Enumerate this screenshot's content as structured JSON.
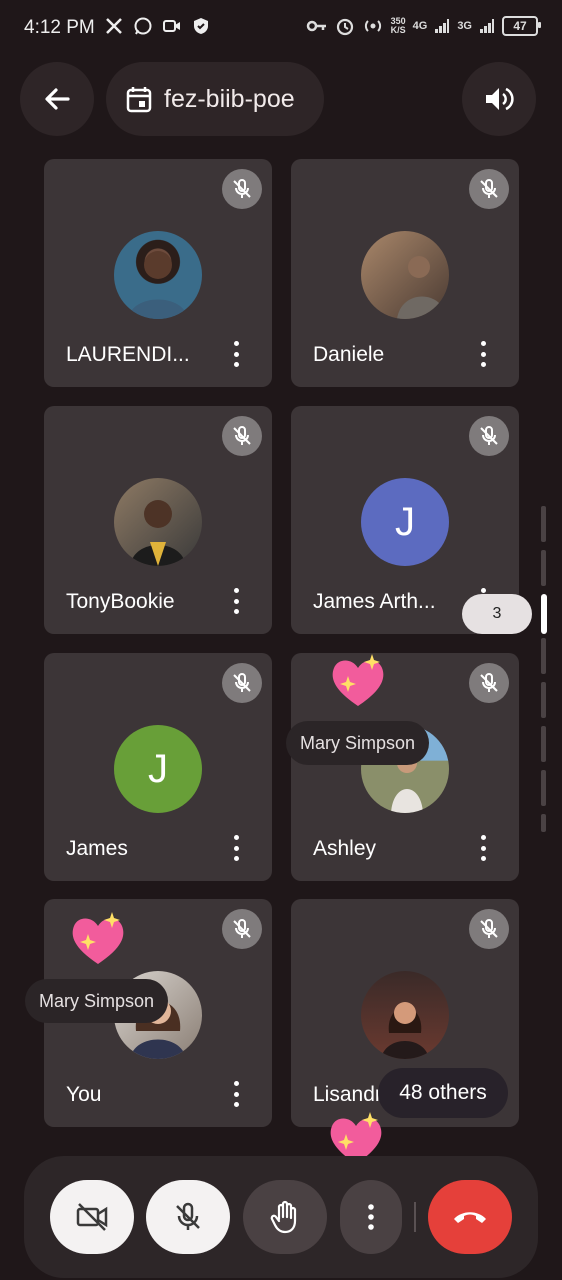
{
  "status_bar": {
    "time": "4:12 PM",
    "net_speed_value": "350",
    "net_speed_unit": "K/S",
    "net_type_1": "4G",
    "net_type_2": "3G",
    "battery": "47"
  },
  "top_bar": {
    "meeting_code": "fez-biib-poe"
  },
  "tiles": [
    {
      "name": "LAURENDI...",
      "muted": true,
      "avatar_type": "photo"
    },
    {
      "name": "Daniele",
      "muted": true,
      "avatar_type": "photo"
    },
    {
      "name": "TonyBookie",
      "muted": true,
      "avatar_type": "photo"
    },
    {
      "name": "James Arth...",
      "muted": true,
      "avatar_type": "initial",
      "initial": "J",
      "color": "#5c6bc0"
    },
    {
      "name": "James",
      "muted": true,
      "avatar_type": "initial",
      "initial": "J",
      "color": "#689f38"
    },
    {
      "name": "Ashley",
      "muted": true,
      "avatar_type": "photo"
    },
    {
      "name": "You",
      "muted": true,
      "avatar_type": "photo"
    },
    {
      "name": "Lisandro",
      "muted": true,
      "avatar_type": "photo"
    }
  ],
  "reactions": [
    {
      "emoji": "sparkling-heart",
      "sender": "Mary Simpson"
    },
    {
      "emoji": "sparkling-heart",
      "sender": "Mary Simpson"
    },
    {
      "emoji": "sparkling-heart"
    }
  ],
  "pagination": {
    "current_page": "3"
  },
  "others_chip": {
    "label": "48 others"
  },
  "controls": {
    "camera": "camera-off-icon",
    "mic": "mic-off-icon",
    "hand": "raise-hand-icon",
    "more": "more-vert-icon",
    "end_call": "call-end-icon"
  },
  "colors": {
    "background": "#1f1719",
    "tile": "#3c3537",
    "end_call": "#e5403a",
    "avatar_indigo": "#5c6bc0",
    "avatar_green": "#689f38"
  }
}
